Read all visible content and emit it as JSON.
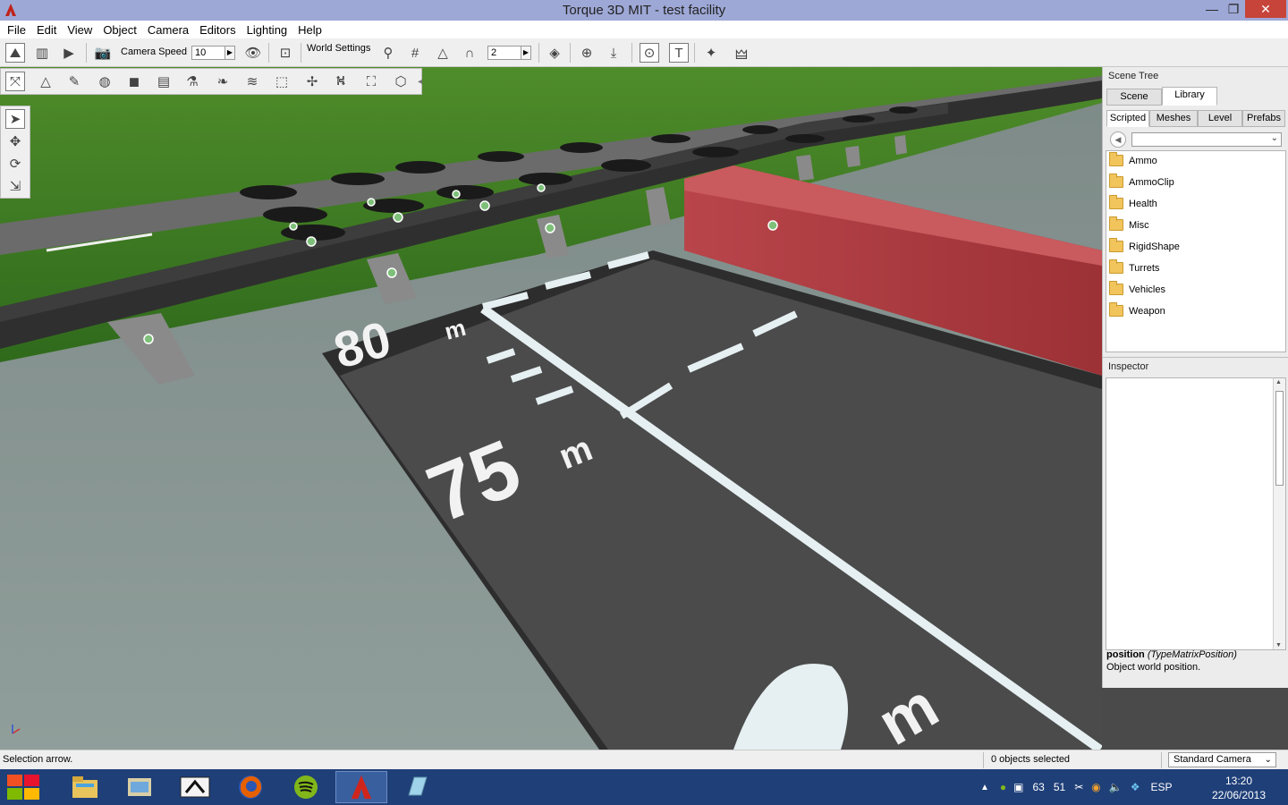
{
  "window": {
    "title": "Torque 3D MIT - test facility",
    "min": "—",
    "max": "❐",
    "close": "✕"
  },
  "menu": [
    "File",
    "Edit",
    "View",
    "Object",
    "Camera",
    "Editors",
    "Lighting",
    "Help"
  ],
  "toolbar": {
    "camera_speed_label": "Camera Speed",
    "camera_speed_value": "10",
    "world_settings_label": "World Settings",
    "snap_value": "2"
  },
  "scene_tree": {
    "title": "Scene Tree",
    "tabs": [
      "Scene",
      "Library"
    ],
    "active_tab": "Library",
    "subtabs": [
      "Scripted",
      "Meshes",
      "Level",
      "Prefabs"
    ],
    "active_subtab": "Scripted",
    "items": [
      "Ammo",
      "AmmoClip",
      "Health",
      "Misc",
      "RigidShape",
      "Turrets",
      "Vehicles",
      "Weapon"
    ]
  },
  "inspector": {
    "title": "Inspector",
    "field_name": "position",
    "field_type": "(TypeMatrixPosition)",
    "field_desc": "Object world position."
  },
  "status": {
    "left": "Selection arrow.",
    "selected": "0 objects selected",
    "camera_mode": "Standard Camera"
  },
  "scene": {
    "markings": [
      "80",
      "m",
      "75",
      "m",
      "m"
    ]
  },
  "taskbar": {
    "tray_lang": "ESP",
    "tray_num1": "63",
    "tray_num2": "51",
    "time": "13:20",
    "date": "22/06/2013"
  },
  "colors": {
    "titlebar": "#9ea8d6",
    "taskbar": "#1f3f78",
    "close": "#c7443a"
  }
}
